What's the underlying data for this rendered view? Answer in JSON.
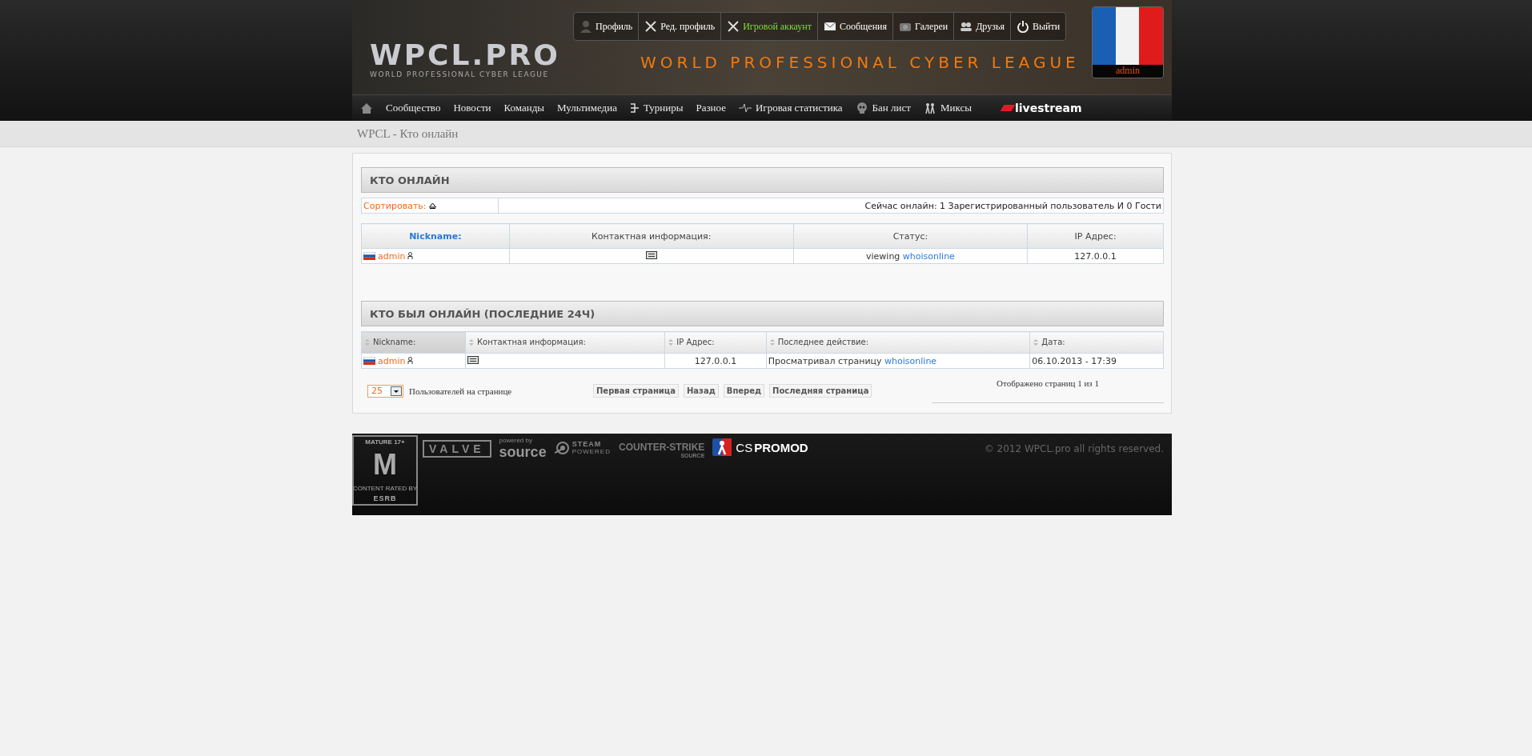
{
  "header": {
    "logo": {
      "title": "WPCL.PRO",
      "subtitle": "WORLD PROFESSIONAL CYBER LEAGUE"
    },
    "tagline": "WORLD PROFESSIONAL CYBER LEAGUE",
    "user_menu": [
      {
        "kind": "profile",
        "label": "Профиль",
        "color": "#ffffff"
      },
      {
        "kind": "edit",
        "label": "Ред. профиль",
        "color": "#ffffff"
      },
      {
        "kind": "edit",
        "label": "Игровой аккаунт",
        "color": "#7ddc3c"
      },
      {
        "kind": "mail",
        "label": "Сообщения",
        "color": "#ffffff"
      },
      {
        "kind": "camera",
        "label": "Галереи",
        "color": "#ffffff"
      },
      {
        "kind": "people",
        "label": "Друзья",
        "color": "#ffffff"
      },
      {
        "kind": "power",
        "label": "Выйти",
        "color": "#ffffff"
      }
    ],
    "avatar": {
      "name": "admin"
    }
  },
  "nav": [
    {
      "kind": "home"
    },
    {
      "kind": "text",
      "label": "Сообщество"
    },
    {
      "kind": "text",
      "label": "Новости"
    },
    {
      "kind": "text",
      "label": "Команды"
    },
    {
      "kind": "text",
      "label": "Мультимедиа"
    },
    {
      "kind": "bracket",
      "label": "Турниры"
    },
    {
      "kind": "text",
      "label": "Разное"
    },
    {
      "kind": "pulse",
      "label": "Игровая статистика"
    },
    {
      "kind": "skull",
      "label": "Бан лист"
    },
    {
      "kind": "players",
      "label": "Миксы"
    },
    {
      "kind": "livestream",
      "label": "livestream"
    }
  ],
  "breadcrumb": "WPCL - Кто онлайн",
  "online": {
    "title": "КТО ОНЛАЙН",
    "sort_label": "Сортировать:",
    "summary": "Сейчас онлайн: 1 Зарегистрированный пользователь И 0 Гости",
    "kind": "simple",
    "columns": [
      {
        "label": "Nickname:",
        "sorted": true
      },
      {
        "label": "Контактная информация:",
        "sorted": false
      },
      {
        "label": "Статус:",
        "sorted": false
      },
      {
        "label": "IP Адрес:",
        "sorted": false
      }
    ],
    "rows": [
      {
        "nickname": "admin",
        "status": "viewing",
        "status_link": "whoisonline",
        "ip": "127.0.0.1"
      }
    ]
  },
  "recent": {
    "title": "КТО БЫЛ ОНЛАЙН (ПОСЛЕДНИЕ 24Ч)",
    "kind": "sortable",
    "columns": [
      {
        "label": "Nickname:",
        "sorted": true
      },
      {
        "label": "Контактная информация:",
        "sorted": false
      },
      {
        "label": "IP Адрес:",
        "sorted": false
      },
      {
        "label": "Последнее действие:",
        "sorted": false
      },
      {
        "label": "Дата:",
        "sorted": false
      }
    ],
    "rows": [
      {
        "nickname": "admin",
        "ip": "127.0.0.1",
        "action": "Просматривал страницу",
        "action_link": "whoisonline",
        "date": "06.10.2013 - 17:39"
      }
    ]
  },
  "pagination": {
    "per_page": "25",
    "per_page_label": "Пользователей на странице",
    "buttons": [
      "Первая страница",
      "Назад",
      "Вперед",
      "Последняя страница"
    ],
    "info": "Отображено страниц 1 из 1"
  },
  "footer": {
    "logos": [
      {
        "kind": "esrb",
        "texts": [
          "MATURE 17+",
          "M",
          "CONTENT RATED BY",
          "ESRB"
        ]
      },
      {
        "kind": "valve",
        "texts": [
          "VALVE"
        ]
      },
      {
        "kind": "source",
        "texts": [
          "powered by",
          "source"
        ]
      },
      {
        "kind": "steam",
        "texts": [
          "STEAM",
          "POWERED"
        ]
      },
      {
        "kind": "css",
        "texts": [
          "COUNTER-STRIKE",
          "SOURCE"
        ]
      },
      {
        "kind": "promod",
        "texts": [
          "CS",
          "PROMOD"
        ]
      }
    ],
    "copyright": "© 2012 WPCL.pro all rights reserved."
  }
}
